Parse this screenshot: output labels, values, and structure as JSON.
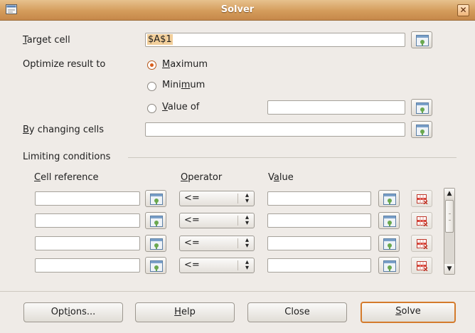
{
  "window": {
    "title": "Solver",
    "close_glyph": "✕"
  },
  "target": {
    "label": "Target cell",
    "value": "$A$1"
  },
  "optimize": {
    "label": "Optimize result to",
    "options": [
      {
        "label": "Maximum",
        "selected": true
      },
      {
        "label": "Minimum",
        "selected": false
      },
      {
        "label": "Value of",
        "selected": false
      }
    ],
    "value_of": ""
  },
  "changing": {
    "label": "By changing cells",
    "value": ""
  },
  "limits": {
    "section": "Limiting conditions",
    "headers": {
      "cell": "Cell reference",
      "operator": "Operator",
      "value": "Value"
    },
    "rows": [
      {
        "cell": "",
        "operator": "<=",
        "value": ""
      },
      {
        "cell": "",
        "operator": "<=",
        "value": ""
      },
      {
        "cell": "",
        "operator": "<=",
        "value": ""
      },
      {
        "cell": "",
        "operator": "<=",
        "value": ""
      }
    ]
  },
  "buttons": {
    "options": "Options...",
    "help": "Help",
    "close": "Close",
    "solve": "Solve"
  },
  "colors": {
    "accent": "#d47b2c",
    "titlebar": "#d49c5b",
    "selection": "#f2cf9b"
  },
  "icons": {
    "shrink": "shrink-range-icon",
    "delete": "delete-condition-icon"
  }
}
